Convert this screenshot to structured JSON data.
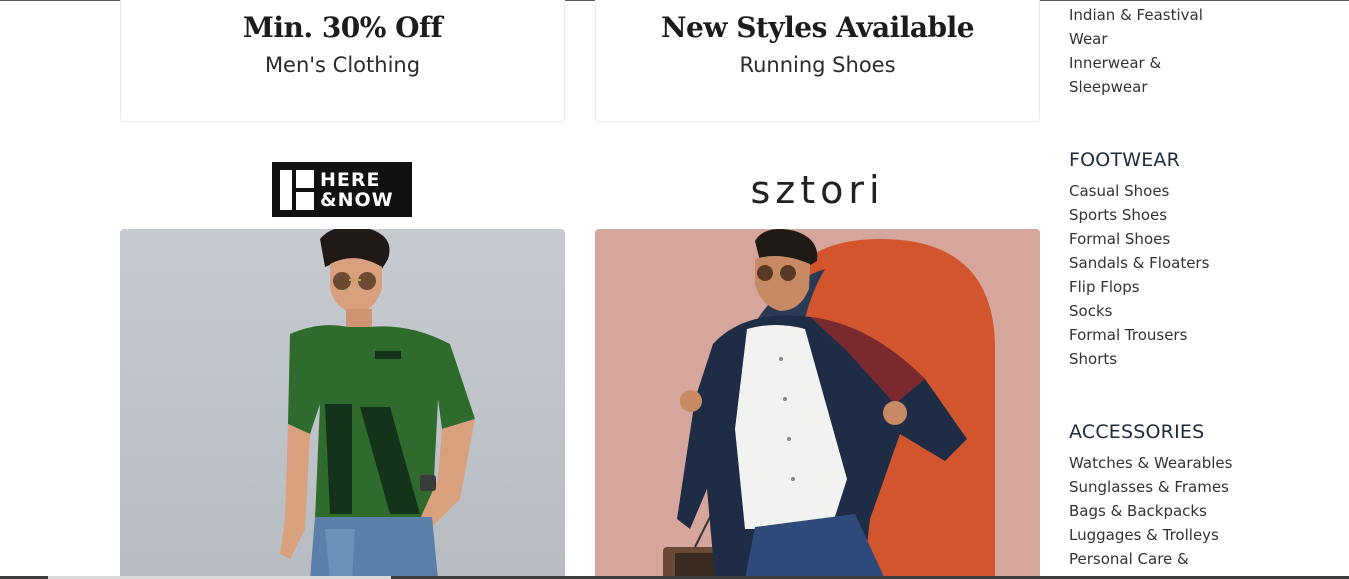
{
  "offers": [
    {
      "title": "Min. 30% Off",
      "subtitle": "Men's Clothing"
    },
    {
      "title": "New Styles Available",
      "subtitle": "Running Shoes"
    }
  ],
  "brands": {
    "left_logo_text": "HERE\n&NOW",
    "right_logo_text": "sztori"
  },
  "sidebar": {
    "clothing_tail": [
      "Indian & Feastival",
      "Wear",
      "Innerwear &",
      "Sleepwear"
    ],
    "footwear_heading": "FOOTWEAR",
    "footwear_items": [
      "Casual Shoes",
      "Sports Shoes",
      "Formal Shoes",
      "Sandals & Floaters",
      "Flip Flops",
      "Socks",
      "Formal Trousers",
      "Shorts"
    ],
    "accessories_heading": "ACCESSORIES",
    "accessories_items": [
      "Watches & Wearables",
      "Sunglasses & Frames",
      "Bags & Backpacks",
      "Luggages & Trolleys",
      "Personal Care &"
    ]
  },
  "colors": {
    "background": "#ffffff",
    "text": "#333333",
    "tshirt_green": "#2f6b2c",
    "orange_arch": "#d2552e"
  }
}
